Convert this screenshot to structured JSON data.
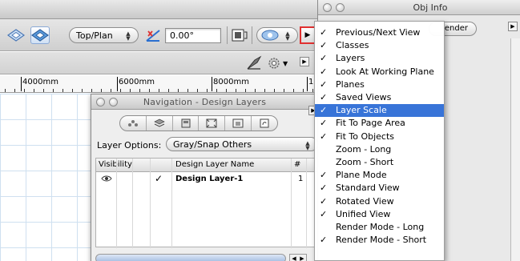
{
  "view_bar": {
    "view_plane": "Top/Plan",
    "rotation": "0.00°"
  },
  "ruler": {
    "labels": [
      "4000mm",
      "6000mm",
      "8000mm",
      "1"
    ]
  },
  "nav_palette": {
    "title": "Navigation - Design Layers",
    "layer_options_label": "Layer Options:",
    "layer_options_value": "Gray/Snap Others",
    "columns": {
      "visibility": "Visibility",
      "name": "Design Layer Name",
      "number": "#"
    },
    "rows": [
      {
        "name": "Design Layer-1",
        "number": "1",
        "active": "✓"
      }
    ]
  },
  "obj_info": {
    "title": "Obj Info",
    "render_tab": "ender"
  },
  "view_menu": {
    "items": [
      {
        "label": "Previous/Next View",
        "checked": "✓"
      },
      {
        "label": "Classes",
        "checked": "✓"
      },
      {
        "label": "Layers",
        "checked": "✓"
      },
      {
        "label": "Look At Working Plane",
        "checked": "✓"
      },
      {
        "label": "Planes",
        "checked": "✓"
      },
      {
        "label": "Saved Views",
        "checked": "✓"
      },
      {
        "label": "Layer Scale",
        "checked": "✓",
        "selected": true
      },
      {
        "label": "Fit To Page Area",
        "checked": "✓"
      },
      {
        "label": "Fit To Objects",
        "checked": "✓"
      },
      {
        "label": "Zoom - Long",
        "checked": ""
      },
      {
        "label": "Zoom - Short",
        "checked": ""
      },
      {
        "label": "Plane Mode",
        "checked": "✓"
      },
      {
        "label": "Standard View",
        "checked": "✓"
      },
      {
        "label": "Rotated View",
        "checked": "✓"
      },
      {
        "label": "Unified View",
        "checked": "✓"
      },
      {
        "label": "Render Mode - Long",
        "checked": ""
      },
      {
        "label": "Render Mode - Short",
        "checked": "✓"
      }
    ]
  },
  "colors": {
    "menu_highlight": "#3874d8",
    "callout_border": "#e03030",
    "grid": "#cfe0f0"
  }
}
